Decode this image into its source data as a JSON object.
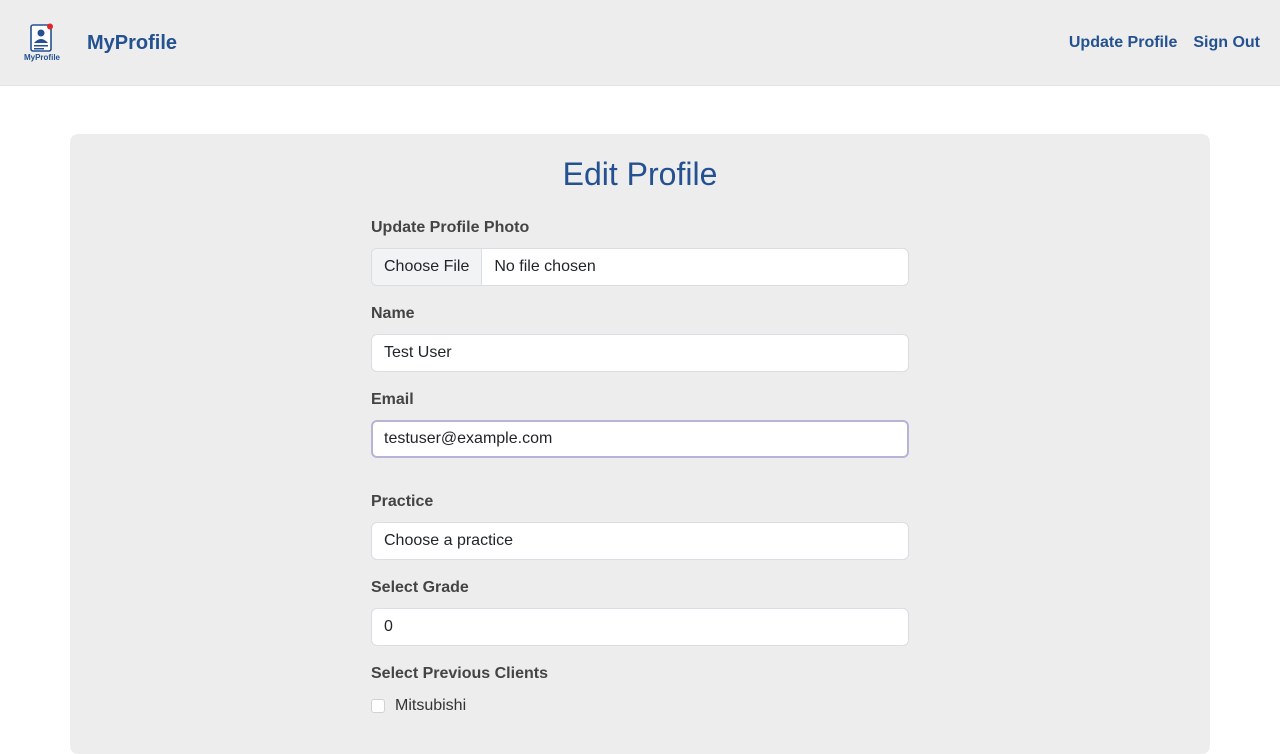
{
  "app": {
    "brand_name": "MyProfile",
    "logo_text": "MyProfile",
    "colors": {
      "brand": "#245190",
      "accent_dot": "#e0262c",
      "nav_bg": "#ededed",
      "card_bg": "#ededed"
    }
  },
  "nav": {
    "links": [
      {
        "label": "Update Profile"
      },
      {
        "label": "Sign Out"
      }
    ]
  },
  "form": {
    "title": "Edit Profile",
    "photo": {
      "label": "Update Profile Photo",
      "button": "Choose File",
      "status": "No file chosen"
    },
    "name": {
      "label": "Name",
      "value": "Test User"
    },
    "email": {
      "label": "Email",
      "value": "testuser@example.com"
    },
    "practice": {
      "label": "Practice",
      "selected": "Choose a practice"
    },
    "grade": {
      "label": "Select Grade",
      "value": "0"
    },
    "clients": {
      "label": "Select Previous Clients",
      "options": [
        {
          "label": "Mitsubishi",
          "checked": false
        }
      ]
    }
  }
}
